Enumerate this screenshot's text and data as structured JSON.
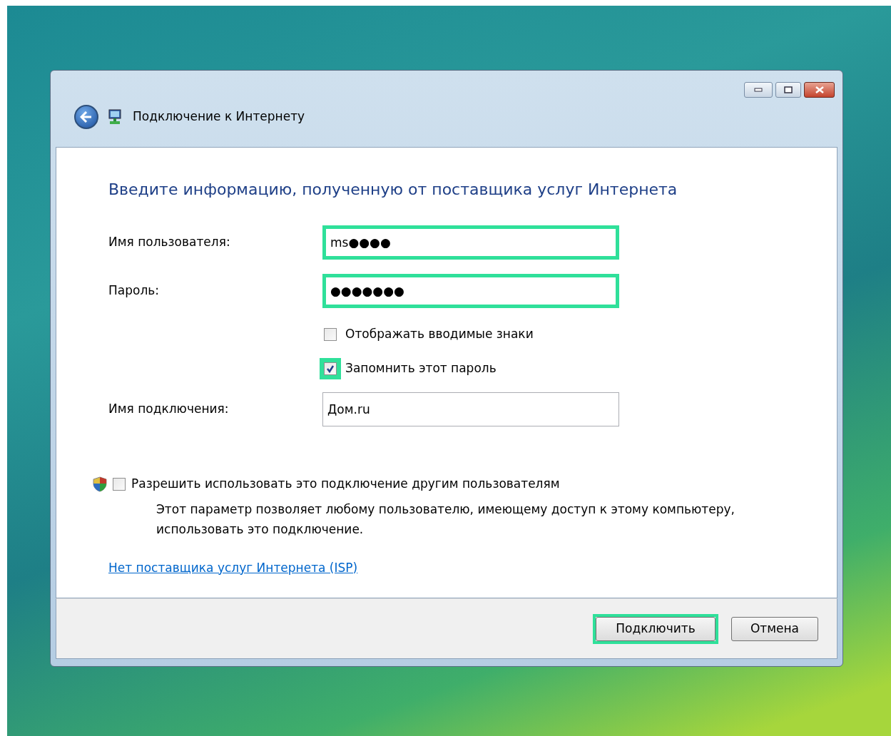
{
  "window": {
    "title": "Подключение к Интернету"
  },
  "heading": "Введите информацию, полученную от поставщика услуг Интернета",
  "fields": [
    {
      "label": "Имя пользователя:",
      "value": "ms●●●●",
      "highlighted": true
    },
    {
      "label": "Пароль:",
      "value": "●●●●●●●",
      "highlighted": true
    }
  ],
  "password_options": [
    {
      "label": "Отображать вводимые знаки",
      "checked": false,
      "highlighted": false
    },
    {
      "label": "Запомнить этот пароль",
      "checked": true,
      "highlighted": true
    }
  ],
  "connection_name": {
    "label": "Имя подключения:",
    "value": "Дом.ru",
    "highlighted": false
  },
  "share_option": {
    "label": "Разрешить использовать это подключение другим пользователям",
    "checked": false,
    "description": "Этот параметр позволяет любому пользователю, имеющему доступ к этому компьютеру, использовать это подключение."
  },
  "link": "Нет поставщика услуг Интернета (ISP)",
  "buttons": [
    {
      "label": "Подключить",
      "highlighted": true
    },
    {
      "label": "Отмена",
      "highlighted": false
    }
  ]
}
